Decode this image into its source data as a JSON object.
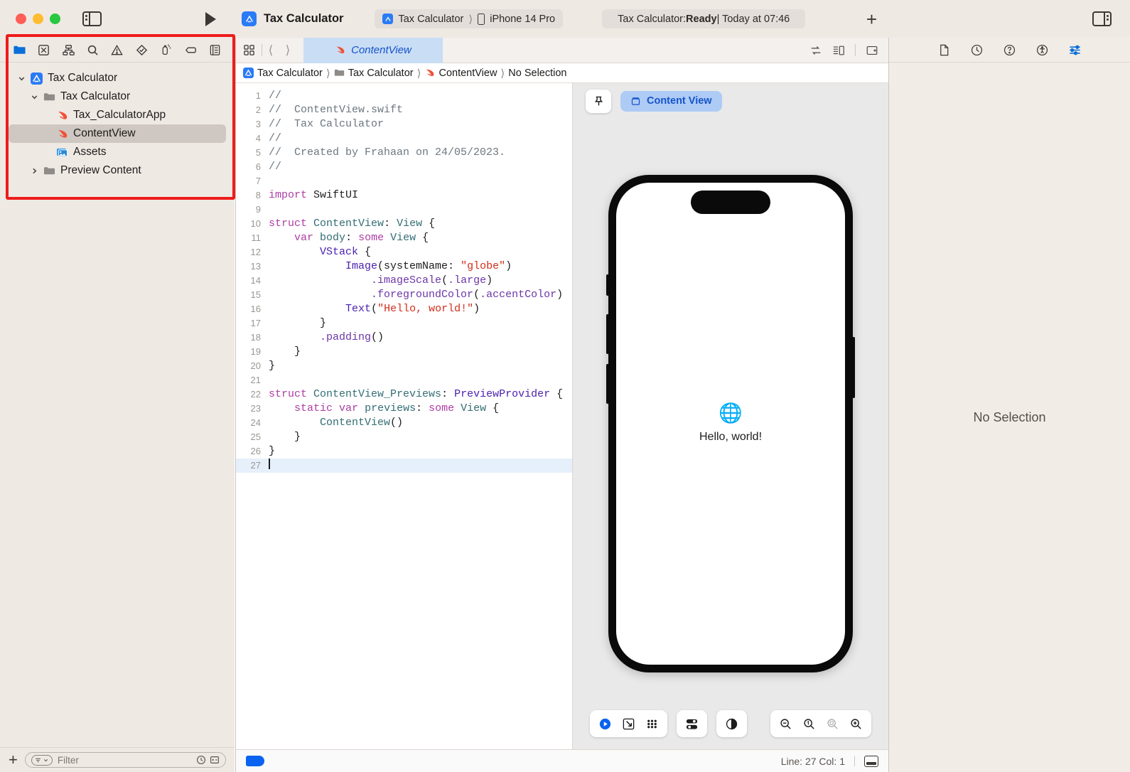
{
  "window": {
    "traffic_lights": [
      "close",
      "minimize",
      "zoom"
    ],
    "project_name": "Tax Calculator",
    "scheme": "Tax Calculator",
    "destination": "iPhone 14 Pro",
    "status_prefix": "Tax Calculator: ",
    "status_state": "Ready",
    "status_suffix": " | Today at 07:46",
    "add_label": "+"
  },
  "navigator": {
    "icons": [
      {
        "name": "project-navigator-icon",
        "label": "Project"
      },
      {
        "name": "source-control-navigator-icon",
        "label": "Source Control"
      },
      {
        "name": "symbol-navigator-icon",
        "label": "Symbols"
      },
      {
        "name": "find-navigator-icon",
        "label": "Find"
      },
      {
        "name": "issue-navigator-icon",
        "label": "Issues"
      },
      {
        "name": "test-navigator-icon",
        "label": "Tests"
      },
      {
        "name": "debug-navigator-icon",
        "label": "Debug"
      },
      {
        "name": "breakpoint-navigator-icon",
        "label": "Breakpoints"
      },
      {
        "name": "report-navigator-icon",
        "label": "Reports"
      }
    ],
    "tree": [
      {
        "label": "Tax Calculator",
        "indent": 0,
        "icon": "app-icon",
        "twisty": "down",
        "selected": false
      },
      {
        "label": "Tax Calculator",
        "indent": 1,
        "icon": "folder-icon",
        "twisty": "down",
        "selected": false
      },
      {
        "label": "Tax_CalculatorApp",
        "indent": 2,
        "icon": "swift-icon",
        "twisty": "none",
        "selected": false
      },
      {
        "label": "ContentView",
        "indent": 2,
        "icon": "swift-icon",
        "twisty": "none",
        "selected": true
      },
      {
        "label": "Assets",
        "indent": 2,
        "icon": "assets-icon",
        "twisty": "none",
        "selected": false
      },
      {
        "label": "Preview Content",
        "indent": 1,
        "icon": "folder-icon",
        "twisty": "right",
        "selected": false
      }
    ],
    "filter_placeholder": "Filter",
    "add_label": "+"
  },
  "editor": {
    "tab_label": "ContentView",
    "breadcrumb": [
      {
        "label": "Tax Calculator",
        "icon": "app-icon"
      },
      {
        "label": "Tax Calculator",
        "icon": "folder-icon"
      },
      {
        "label": "ContentView",
        "icon": "swift-icon"
      },
      {
        "label": "No Selection",
        "icon": "none"
      }
    ],
    "code_lines": [
      {
        "n": 1,
        "tokens": [
          {
            "t": "//",
            "c": "cm"
          }
        ]
      },
      {
        "n": 2,
        "tokens": [
          {
            "t": "//  ContentView.swift",
            "c": "cm"
          }
        ]
      },
      {
        "n": 3,
        "tokens": [
          {
            "t": "//  Tax Calculator",
            "c": "cm"
          }
        ]
      },
      {
        "n": 4,
        "tokens": [
          {
            "t": "//",
            "c": "cm"
          }
        ]
      },
      {
        "n": 5,
        "tokens": [
          {
            "t": "//  Created by Frahaan on 24/05/2023.",
            "c": "cm"
          }
        ]
      },
      {
        "n": 6,
        "tokens": [
          {
            "t": "//",
            "c": "cm"
          }
        ]
      },
      {
        "n": 7,
        "tokens": []
      },
      {
        "n": 8,
        "tokens": [
          {
            "t": "import",
            "c": "kw"
          },
          {
            "t": " SwiftUI",
            "c": "ct"
          }
        ]
      },
      {
        "n": 9,
        "tokens": []
      },
      {
        "n": 10,
        "tokens": [
          {
            "t": "struct",
            "c": "kw"
          },
          {
            "t": " ",
            "c": "ct"
          },
          {
            "t": "ContentView",
            "c": "ty"
          },
          {
            "t": ": ",
            "c": "ct"
          },
          {
            "t": "View",
            "c": "ty"
          },
          {
            "t": " {",
            "c": "ct"
          }
        ]
      },
      {
        "n": 11,
        "tokens": [
          {
            "t": "    ",
            "c": "ct"
          },
          {
            "t": "var",
            "c": "kw"
          },
          {
            "t": " ",
            "c": "ct"
          },
          {
            "t": "body",
            "c": "ty"
          },
          {
            "t": ": ",
            "c": "ct"
          },
          {
            "t": "some",
            "c": "kw"
          },
          {
            "t": " ",
            "c": "ct"
          },
          {
            "t": "View",
            "c": "ty"
          },
          {
            "t": " {",
            "c": "ct"
          }
        ]
      },
      {
        "n": 12,
        "tokens": [
          {
            "t": "        ",
            "c": "ct"
          },
          {
            "t": "VStack",
            "c": "tyb"
          },
          {
            "t": " {",
            "c": "ct"
          }
        ]
      },
      {
        "n": 13,
        "tokens": [
          {
            "t": "            ",
            "c": "ct"
          },
          {
            "t": "Image",
            "c": "tyb"
          },
          {
            "t": "(systemName: ",
            "c": "ct"
          },
          {
            "t": "\"globe\"",
            "c": "str"
          },
          {
            "t": ")",
            "c": "ct"
          }
        ]
      },
      {
        "n": 14,
        "tokens": [
          {
            "t": "                ",
            "c": "ct"
          },
          {
            "t": ".imageScale",
            "c": "mth"
          },
          {
            "t": "(",
            "c": "ct"
          },
          {
            "t": ".large",
            "c": "mth"
          },
          {
            "t": ")",
            "c": "ct"
          }
        ]
      },
      {
        "n": 15,
        "tokens": [
          {
            "t": "                ",
            "c": "ct"
          },
          {
            "t": ".foregroundColor",
            "c": "mth"
          },
          {
            "t": "(",
            "c": "ct"
          },
          {
            "t": ".accentColor",
            "c": "mth"
          },
          {
            "t": ")",
            "c": "ct"
          }
        ]
      },
      {
        "n": 16,
        "tokens": [
          {
            "t": "            ",
            "c": "ct"
          },
          {
            "t": "Text",
            "c": "tyb"
          },
          {
            "t": "(",
            "c": "ct"
          },
          {
            "t": "\"Hello, world!\"",
            "c": "str"
          },
          {
            "t": ")",
            "c": "ct"
          }
        ]
      },
      {
        "n": 17,
        "tokens": [
          {
            "t": "        }",
            "c": "ct"
          }
        ]
      },
      {
        "n": 18,
        "tokens": [
          {
            "t": "        ",
            "c": "ct"
          },
          {
            "t": ".padding",
            "c": "mth"
          },
          {
            "t": "()",
            "c": "ct"
          }
        ]
      },
      {
        "n": 19,
        "tokens": [
          {
            "t": "    }",
            "c": "ct"
          }
        ]
      },
      {
        "n": 20,
        "tokens": [
          {
            "t": "}",
            "c": "ct"
          }
        ]
      },
      {
        "n": 21,
        "tokens": []
      },
      {
        "n": 22,
        "tokens": [
          {
            "t": "struct",
            "c": "kw"
          },
          {
            "t": " ",
            "c": "ct"
          },
          {
            "t": "ContentView_Previews",
            "c": "ty"
          },
          {
            "t": ": ",
            "c": "ct"
          },
          {
            "t": "PreviewProvider",
            "c": "tyb"
          },
          {
            "t": " {",
            "c": "ct"
          }
        ]
      },
      {
        "n": 23,
        "tokens": [
          {
            "t": "    ",
            "c": "ct"
          },
          {
            "t": "static",
            "c": "kw"
          },
          {
            "t": " ",
            "c": "ct"
          },
          {
            "t": "var",
            "c": "kw"
          },
          {
            "t": " ",
            "c": "ct"
          },
          {
            "t": "previews",
            "c": "ty"
          },
          {
            "t": ": ",
            "c": "ct"
          },
          {
            "t": "some",
            "c": "kw"
          },
          {
            "t": " ",
            "c": "ct"
          },
          {
            "t": "View",
            "c": "ty"
          },
          {
            "t": " {",
            "c": "ct"
          }
        ]
      },
      {
        "n": 24,
        "tokens": [
          {
            "t": "        ",
            "c": "ct"
          },
          {
            "t": "ContentView",
            "c": "ty"
          },
          {
            "t": "()",
            "c": "ct"
          }
        ]
      },
      {
        "n": 25,
        "tokens": [
          {
            "t": "    }",
            "c": "ct"
          }
        ]
      },
      {
        "n": 26,
        "tokens": [
          {
            "t": "}",
            "c": "ct"
          }
        ]
      },
      {
        "n": 27,
        "tokens": [],
        "highlight": true,
        "cursor": true
      }
    ],
    "status_line": "Line: 27  Col: 1"
  },
  "preview": {
    "pin_label": "pin",
    "variant_label": "Content View",
    "device_content": {
      "icon": "globe-icon",
      "text": "Hello, world!"
    },
    "controls": [
      {
        "name": "preview-play-button",
        "glyph": "play"
      },
      {
        "name": "preview-select-button",
        "glyph": "pointer"
      },
      {
        "name": "preview-variants-button",
        "glyph": "grid"
      },
      {
        "name": "preview-device-settings-button",
        "glyph": "sliders"
      },
      {
        "name": "preview-appearance-button",
        "glyph": "halfcircle"
      }
    ],
    "zoom_controls": [
      {
        "name": "zoom-out-button",
        "glyph": "minus"
      },
      {
        "name": "zoom-actual-size-button",
        "glyph": "one"
      },
      {
        "name": "zoom-to-fit-button",
        "glyph": "fit"
      },
      {
        "name": "zoom-in-button",
        "glyph": "plus"
      }
    ]
  },
  "inspector": {
    "icons": [
      {
        "name": "file-inspector-icon",
        "label": "File"
      },
      {
        "name": "history-inspector-icon",
        "label": "History"
      },
      {
        "name": "quick-help-inspector-icon",
        "label": "Quick Help"
      },
      {
        "name": "accessibility-inspector-icon",
        "label": "Accessibility"
      },
      {
        "name": "attributes-inspector-icon",
        "label": "Attributes"
      }
    ],
    "empty_text": "No Selection"
  },
  "colors": {
    "chrome": "#efe9e4",
    "inspector_bg": "#f2ece7",
    "accent_blue": "#0a63f0",
    "highlight_red": "#ee1c1c",
    "tab_blue": "#c9ddf5",
    "selected_row": "#cfc8c2"
  }
}
